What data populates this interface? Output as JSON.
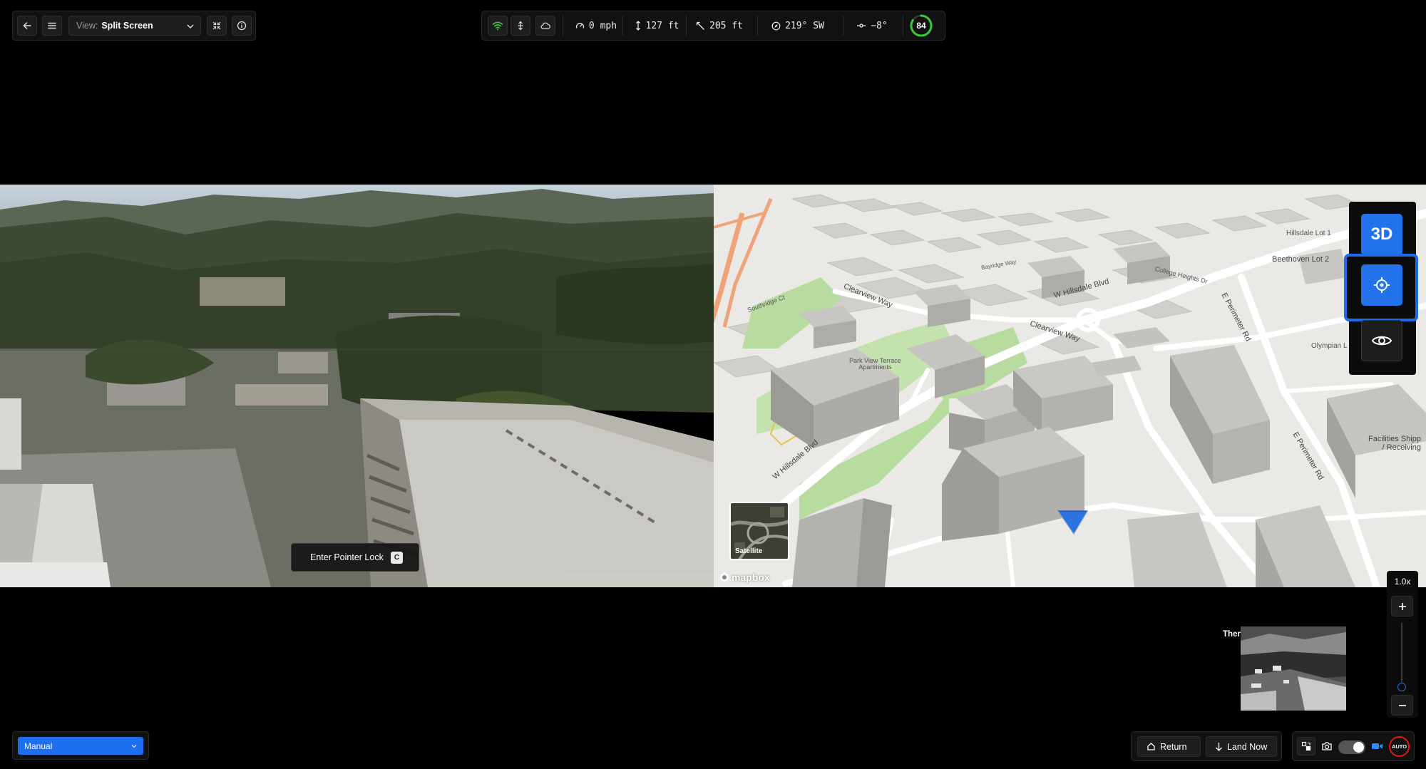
{
  "toolbar": {
    "view_label": "View:",
    "view_value": "Split Screen"
  },
  "telemetry": {
    "speed": "0 mph",
    "altitude": "127 ft",
    "distance": "205 ft",
    "heading": "219° SW",
    "pitch": "−8°",
    "battery": "84",
    "battery_level": 0.84
  },
  "video": {
    "pointer_lock_label": "Enter Pointer Lock",
    "pointer_lock_key": "C"
  },
  "map": {
    "labels": {
      "w_hillsdale_blvd_1": "W Hillsdale Blvd",
      "w_hillsdale_blvd_2": "W Hillsdale Blvd",
      "clearview_way_1": "Clearview Way",
      "clearview_way_2": "Clearview Way",
      "park_view": "Park View Terrace\nApartments",
      "e_perimeter_rd_1": "E Perimeter Rd",
      "e_perimeter_rd_2": "E Perimeter Rd",
      "beethoven": "Beethoven Lot 2",
      "hillsdale_lot": "Hillsdale Lot 1",
      "college_heights": "College Heights Dr",
      "olympian": "Olympian L",
      "facilities": "Facilities Shipp\n/ Receiving",
      "bayridge": "Bayridge Way",
      "southridge": "Southridge Ct"
    },
    "satellite_label": "Satellite",
    "attribution": "mapbox",
    "btn_3d": "3D",
    "zoom_level": "1.0x"
  },
  "thermal": {
    "label": "Thermal"
  },
  "bottom": {
    "mode": "Manual",
    "return_label": "Return",
    "land_label": "Land Now",
    "auto_label": "AUTO"
  },
  "colors": {
    "accent": "#2272ec",
    "battery": "#3ac93a",
    "record": "#e11111"
  }
}
